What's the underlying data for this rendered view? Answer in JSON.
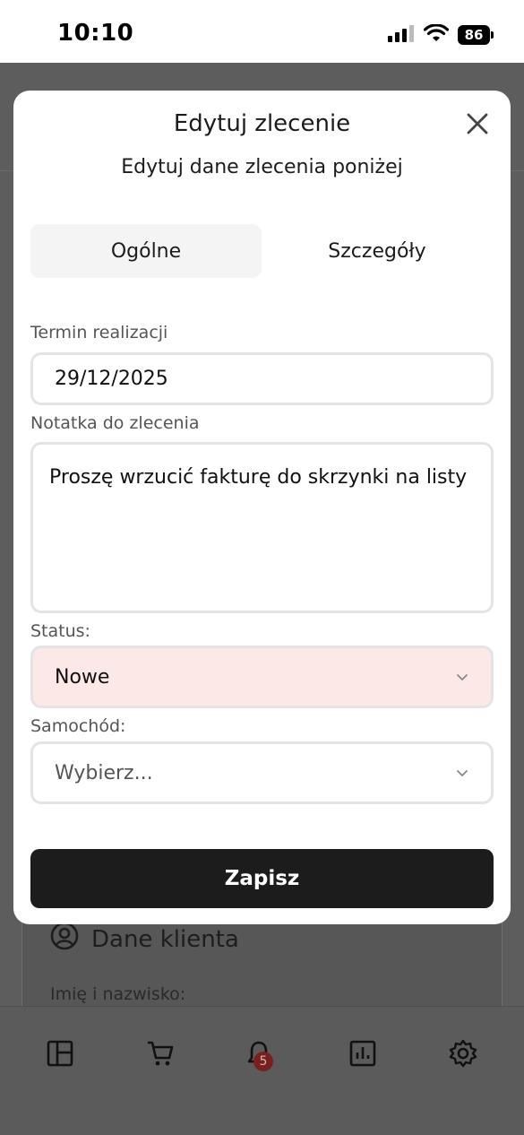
{
  "status_bar": {
    "time": "10:10",
    "battery": "86",
    "icons": [
      "cellular-signal-icon",
      "wifi-icon",
      "battery-icon"
    ]
  },
  "background": {
    "client_section_title": "Dane klienta",
    "client_section_icon": "user-circle-icon",
    "name_label": "Imię i nazwisko:",
    "bottom_nav": {
      "items": [
        "dashboard-icon",
        "cart-icon",
        "bell-icon",
        "reports-icon",
        "settings-icon"
      ],
      "notification_count": "5"
    }
  },
  "modal": {
    "title": "Edytuj zlecenie",
    "subtitle": "Edytuj dane zlecenia poniżej",
    "tabs": [
      {
        "label": "Ogólne",
        "active": true
      },
      {
        "label": "Szczegóły",
        "active": false
      }
    ],
    "deadline": {
      "label": "Termin realizacji",
      "value": "29/12/2025"
    },
    "note": {
      "label": "Notatka do zlecenia",
      "value": "Proszę wrzucić fakturę do skrzynki na listy"
    },
    "status": {
      "label": "Status:",
      "value": "Nowe"
    },
    "car": {
      "label": "Samochód:",
      "placeholder": "Wybierz..."
    },
    "save_label": "Zapisz"
  },
  "colors": {
    "backdrop": "#5d5d5d",
    "status_select_bg": "#fde8e8",
    "save_button_bg": "#1c1c1c",
    "active_tab_bg": "#f4f4f5",
    "badge": "#7a1f1f"
  }
}
